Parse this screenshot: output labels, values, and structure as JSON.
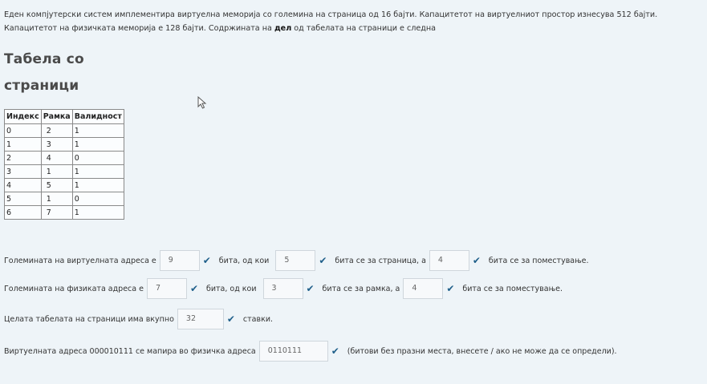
{
  "intro": {
    "line1": "Еден компјутерски систем имплементира виртуелна меморија со големина на страница од 16 бајти.  Капацитетот на виртуелниот простор изнесува 512 бајти.",
    "line2_a": "Капацитетот на физичката меморија е 128 бајти. Содржината на ",
    "line2_bold": "дел",
    "line2_b": " од табелата на страници е следна"
  },
  "heading": {
    "line1": "Табела со",
    "line2": "страници"
  },
  "table": {
    "headers": [
      "Индекс",
      "Рамка",
      "Валидност"
    ],
    "rows": [
      [
        "0",
        "2",
        "1"
      ],
      [
        "1",
        "3",
        "1"
      ],
      [
        "2",
        "4",
        "0"
      ],
      [
        "3",
        "1",
        "1"
      ],
      [
        "4",
        "5",
        "1"
      ],
      [
        "5",
        "1",
        "0"
      ],
      [
        "6",
        "7",
        "1"
      ]
    ]
  },
  "q1": {
    "t1": "Големината на виртуелната адреса е",
    "a1": "9",
    "t2": "бита, од кои",
    "a2": "5",
    "t3": "бита се за страница, а",
    "a3": "4",
    "t4": "бита се за поместување."
  },
  "q2": {
    "t1": "Големината на физиката адреса е",
    "a1": "7",
    "t2": "бита, од кои",
    "a2": "3",
    "t3": "бита се за рамка, а",
    "a3": "4",
    "t4": "бита се за поместување."
  },
  "q3": {
    "t1": "Целата табелата на страници има вкупно",
    "a1": "32",
    "t2": "ставки."
  },
  "q4": {
    "t1": "Виртуелната адреса 000010111 се мапира во физичка адреса",
    "a1": "0110111",
    "t2": "(битови без празни места, внесете / ако не може да се определи)."
  },
  "icons": {
    "check": "check-icon",
    "cursor": "mouse-pointer-icon"
  },
  "colors": {
    "background": "#eef4f8",
    "check": "#1f5f8a"
  }
}
